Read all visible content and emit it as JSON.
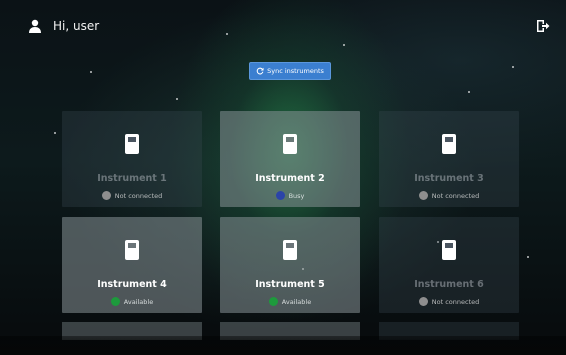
{
  "header": {
    "greeting": "Hi, user",
    "user_icon": "user-icon",
    "logout_icon": "logout-icon"
  },
  "sync": {
    "label": "Sync instruments",
    "icon": "refresh-icon",
    "color": "#3b7fd0"
  },
  "status_colors": {
    "Not connected": "#8e8e8e",
    "Busy": "#2b44a8",
    "Available": "#1d9a3c"
  },
  "instruments": [
    {
      "name": "Instrument 1",
      "status": "Not connected"
    },
    {
      "name": "Instrument 2",
      "status": "Busy"
    },
    {
      "name": "Instrument 3",
      "status": "Not connected"
    },
    {
      "name": "Instrument 4",
      "status": "Available"
    },
    {
      "name": "Instrument 5",
      "status": "Available"
    },
    {
      "name": "Instrument 6",
      "status": "Not connected"
    }
  ]
}
